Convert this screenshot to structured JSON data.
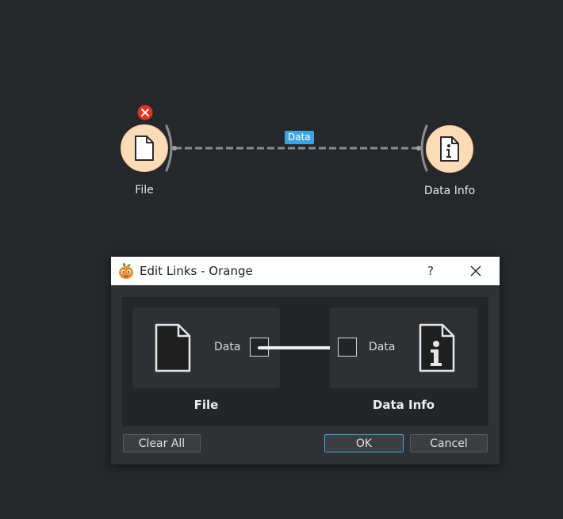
{
  "canvas": {
    "nodes": [
      {
        "label": "File"
      },
      {
        "label": "Data Info"
      }
    ],
    "link_label": "Data",
    "colors": {
      "node_fill": "#fbdcb7",
      "link_label_bg": "#3aa3e3",
      "error_badge": "#e5321c"
    }
  },
  "dialog": {
    "title": "Edit Links - Orange",
    "help": "?",
    "source": {
      "title": "File",
      "channel": "Data"
    },
    "sink": {
      "title": "Data Info",
      "channel": "Data"
    },
    "buttons": {
      "clear_all": "Clear All",
      "ok": "OK",
      "cancel": "Cancel"
    }
  }
}
